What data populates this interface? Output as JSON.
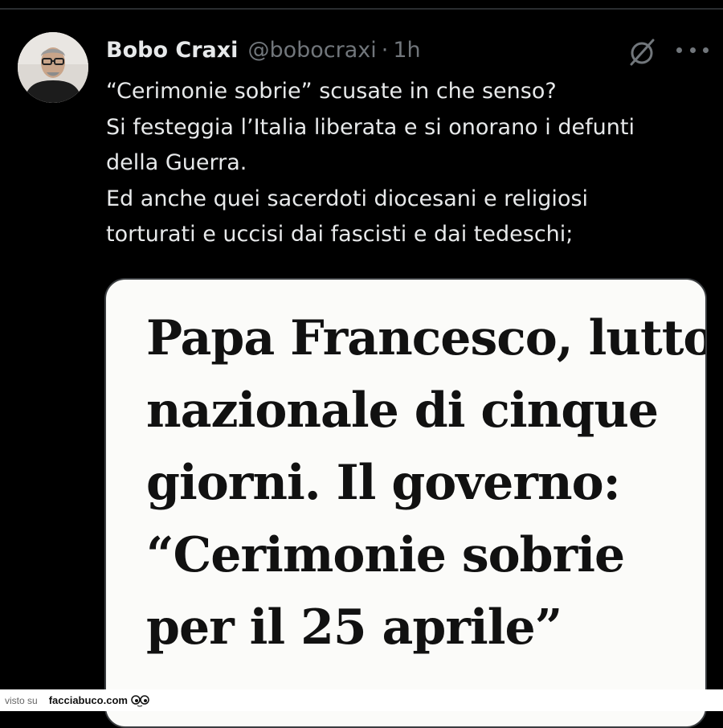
{
  "tweet": {
    "display_name": "Bobo Craxi",
    "handle": "@bobocraxi",
    "separator": "·",
    "time": "1h",
    "text_lines": [
      "“Cerimonie sobrie” scusate in che senso?",
      "Si festeggia l’Italia liberata e si onorano i defunti",
      "della Guerra.",
      "Ed anche quei sacerdoti diocesani e religiosi",
      "torturati e uccisi dai fascisti e dai tedeschi;"
    ]
  },
  "media": {
    "headline_lines": [
      "Papa Francesco, lutto",
      "nazionale di cinque",
      "giorni. Il governo:",
      "“Cerimonie sobrie",
      "per il 25 aprile”"
    ]
  },
  "icons": {
    "grok": "grok-icon",
    "more": "more-options-icon",
    "avatar": "avatar",
    "watermark": "eyes-icon"
  },
  "footer": {
    "visto_label": "visto su",
    "brand": "facciabuco.com"
  },
  "colors": {
    "background": "#000000",
    "text_primary": "#e7e9ea",
    "text_secondary": "#71767b",
    "card_background": "#fbfbf9"
  }
}
